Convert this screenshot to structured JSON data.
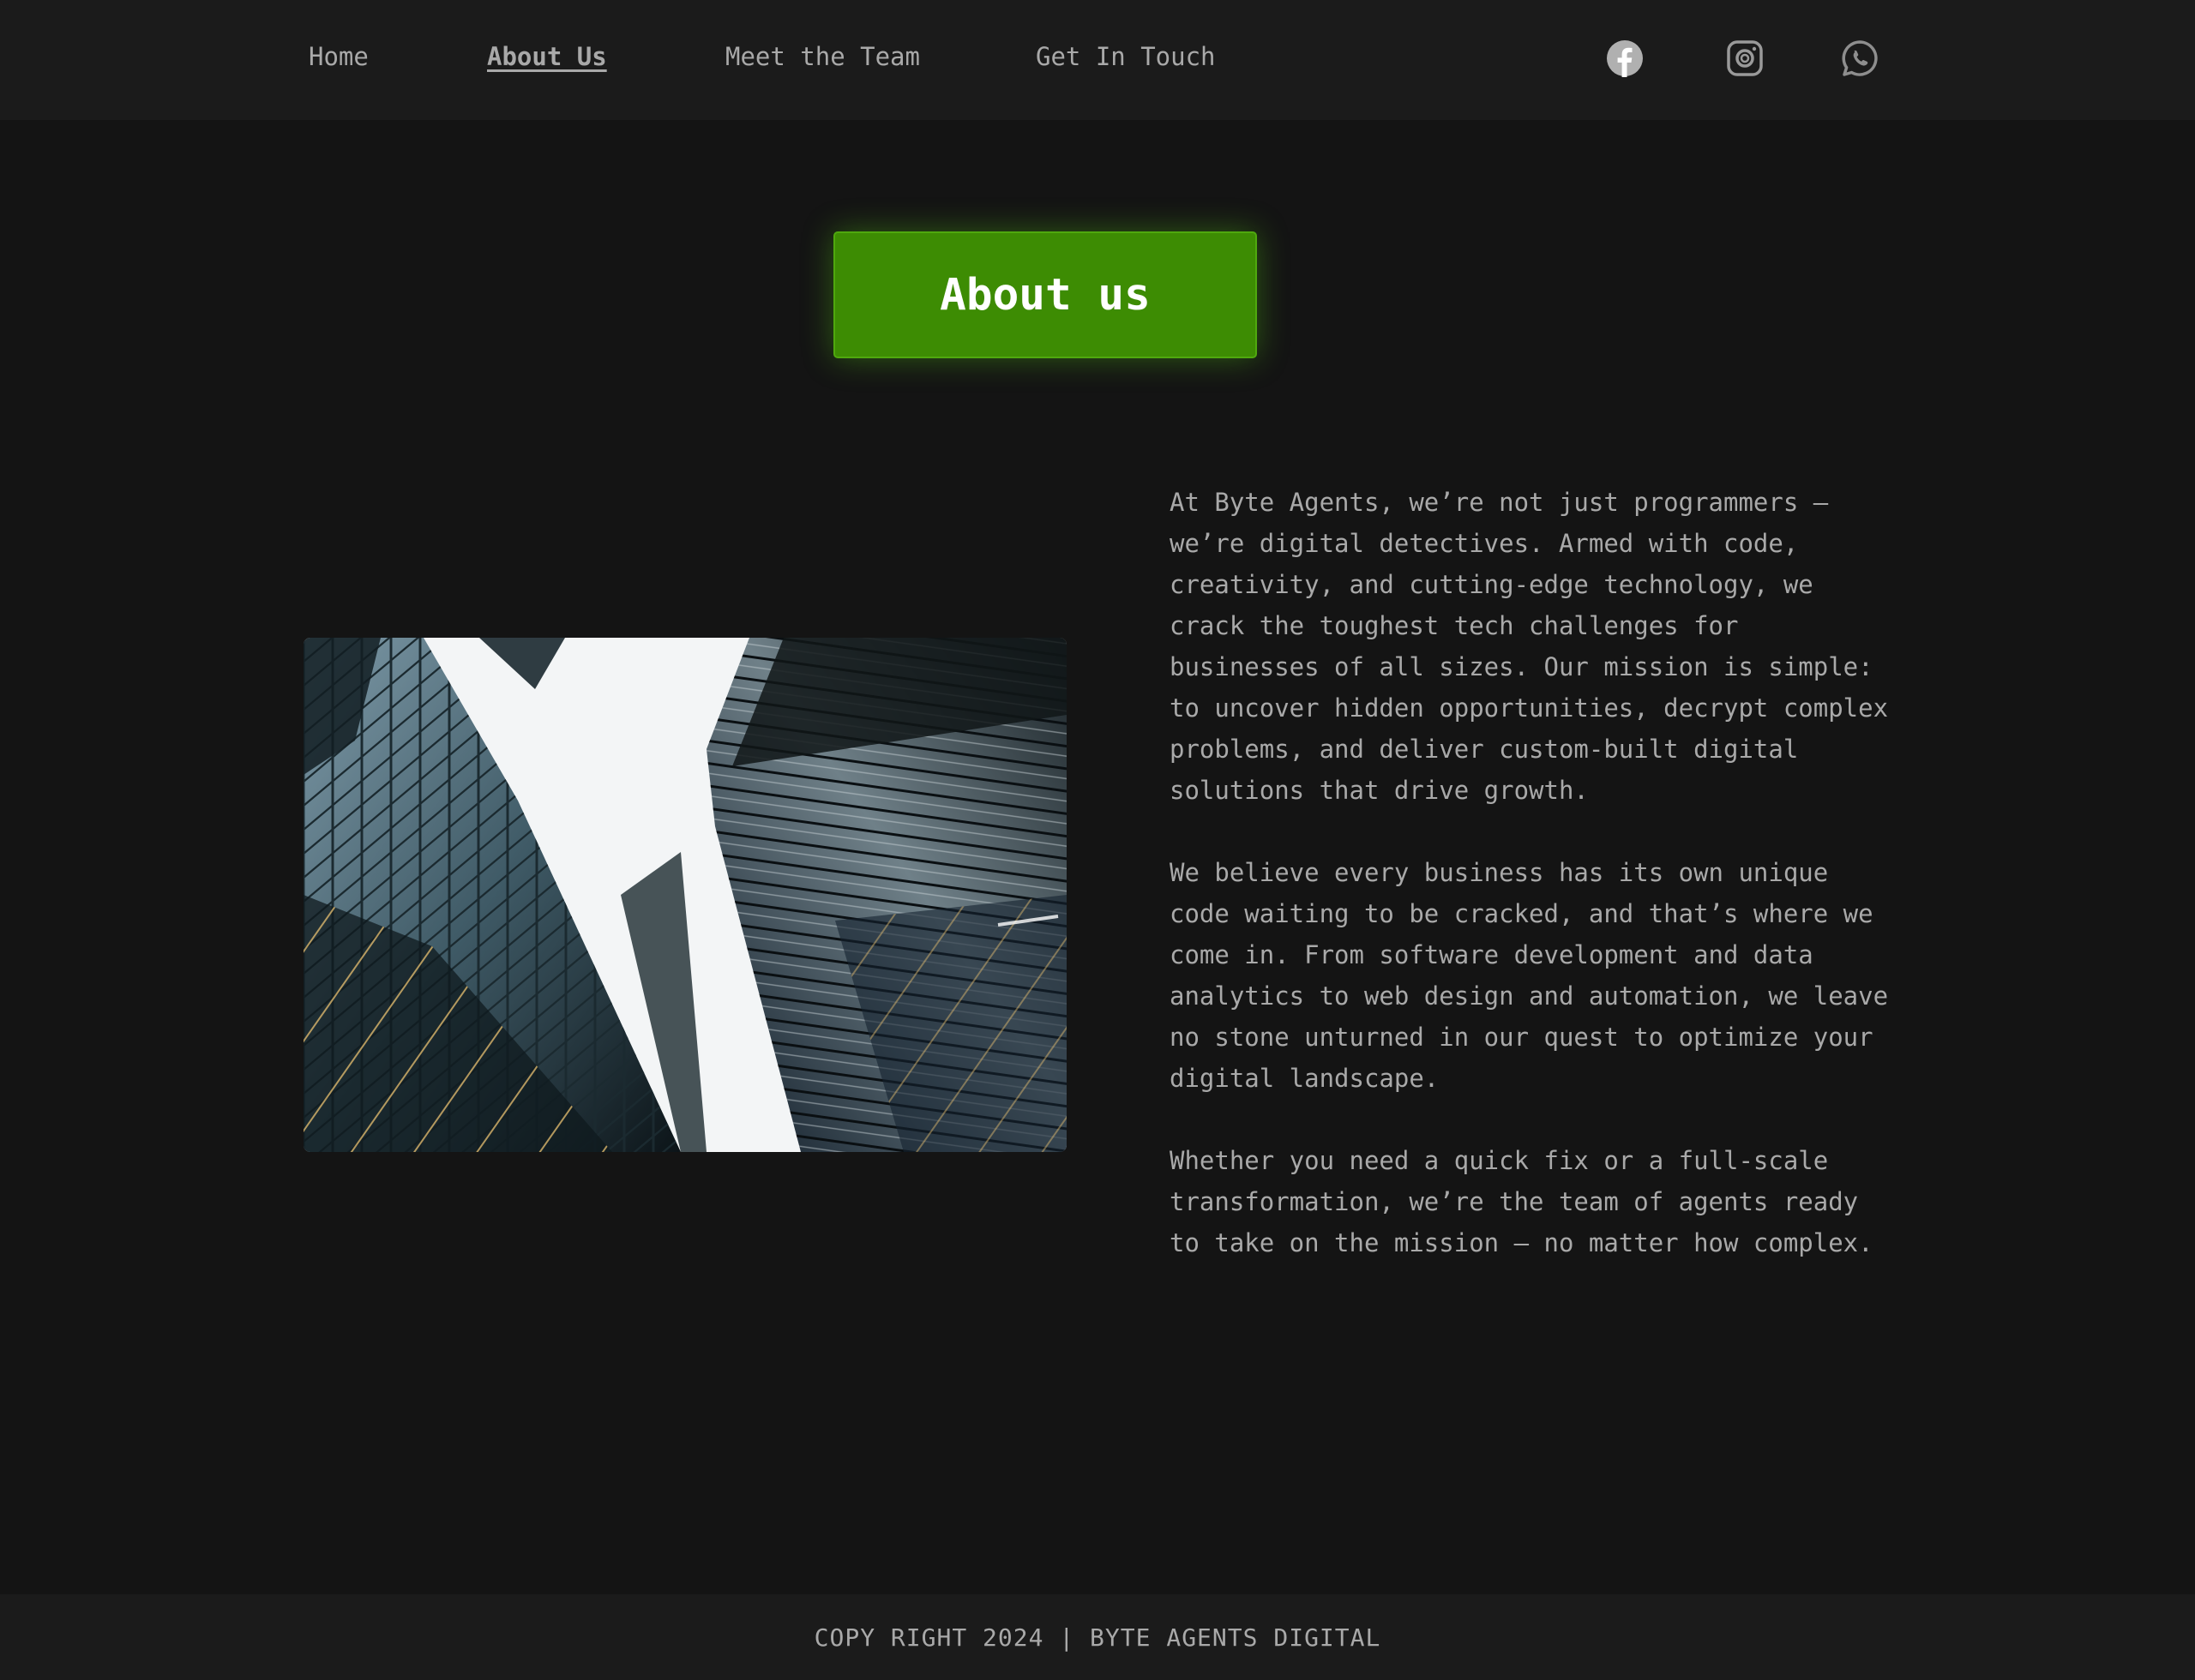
{
  "nav": {
    "links": [
      {
        "label": "Home",
        "active": false
      },
      {
        "label": "About Us",
        "active": true
      },
      {
        "label": "Meet the Team",
        "active": false
      },
      {
        "label": "Get In Touch",
        "active": false
      }
    ],
    "social_icons": [
      "facebook-icon",
      "instagram-icon",
      "whatsapp-icon"
    ]
  },
  "hero": {
    "title": "About us"
  },
  "content": {
    "image_subject": "skyscrapers-looking-up",
    "paragraphs": [
      "At Byte Agents, we’re not just programmers — we’re digital detectives. Armed with code, creativity, and cutting-edge technology, we crack the toughest tech challenges for businesses of all sizes. Our mission is simple: to uncover hidden opportunities, decrypt complex problems, and deliver custom-built digital solutions that drive growth.",
      "We believe every business has its own unique code waiting to be cracked, and that’s where we come in. From software development and data analytics to web design and automation, we leave no stone unturned in our quest to optimize your digital landscape.",
      "Whether you need a quick fix or a full-scale transformation, we’re the team of agents ready to take on the mission — no matter how complex."
    ]
  },
  "footer": {
    "text": "COPY RIGHT 2024 | BYTE AGENTS DIGITAL"
  },
  "colors": {
    "background": "#141414",
    "nav_background": "#1b1b1b",
    "accent_green": "#3d8c03",
    "text": "#a9a9a9"
  }
}
